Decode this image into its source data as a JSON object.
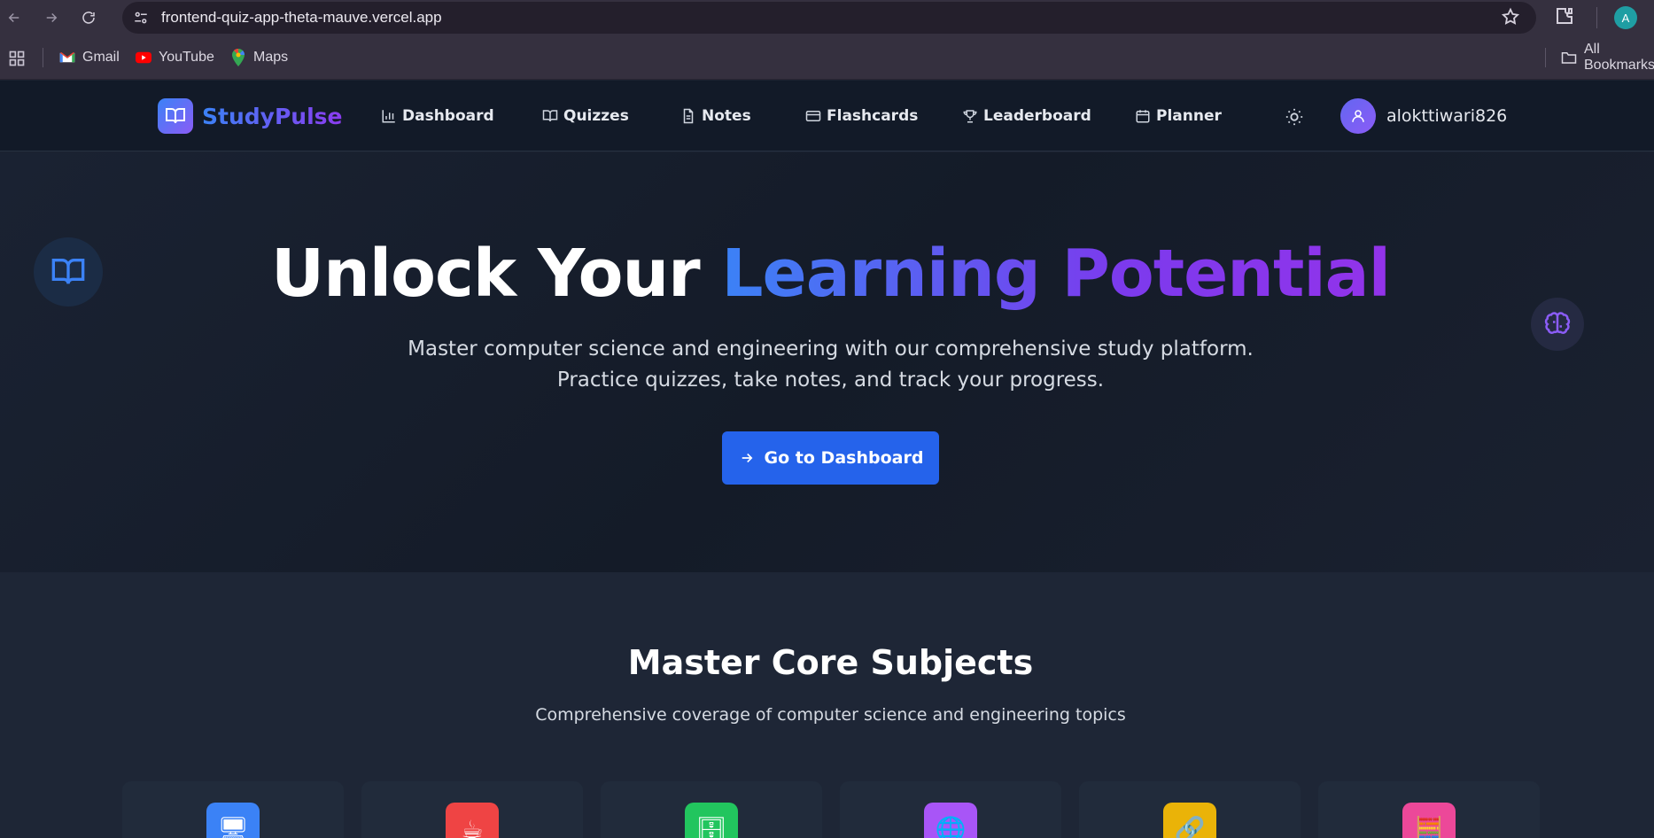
{
  "browser": {
    "url": "frontend-quiz-app-theta-mauve.vercel.app",
    "profile_initial": "A",
    "bookmarks": [
      {
        "label": "Gmail",
        "icon": "gmail-icon"
      },
      {
        "label": "YouTube",
        "icon": "youtube-icon"
      },
      {
        "label": "Maps",
        "icon": "maps-icon"
      }
    ],
    "all_bookmarks": "All Bookmarks"
  },
  "navbar": {
    "brand": "StudyPulse",
    "items": [
      {
        "label": "Dashboard",
        "icon": "bar-chart-icon"
      },
      {
        "label": "Quizzes",
        "icon": "book-open-icon"
      },
      {
        "label": "Notes",
        "icon": "file-text-icon"
      },
      {
        "label": "Flashcards",
        "icon": "card-icon"
      },
      {
        "label": "Leaderboard",
        "icon": "trophy-icon"
      },
      {
        "label": "Planner",
        "icon": "calendar-icon"
      }
    ],
    "username": "alokttiwari826"
  },
  "hero": {
    "title_plain": "Unlock Your ",
    "title_highlight": "Learning Potential",
    "subtitle_line1": "Master computer science and engineering with our comprehensive study platform.",
    "subtitle_line2": "Practice quizzes, take notes, and track your progress.",
    "cta_label": "Go to Dashboard"
  },
  "subjects": {
    "title": "Master Core Subjects",
    "subtitle": "Comprehensive coverage of computer science and engineering topics",
    "cards": [
      {
        "icon": "computer-icon",
        "glyph": "🖥",
        "color": "#3b82f6"
      },
      {
        "icon": "coffee-icon",
        "glyph": "☕",
        "color": "#ef4444"
      },
      {
        "icon": "database-icon",
        "glyph": "🗄",
        "color": "#22c55e"
      },
      {
        "icon": "globe-icon",
        "glyph": "🌐",
        "color": "#a855f7"
      },
      {
        "icon": "link-icon",
        "glyph": "🔗",
        "color": "#eab308"
      },
      {
        "icon": "abacus-icon",
        "glyph": "🧮",
        "color": "#ec4899"
      }
    ]
  }
}
